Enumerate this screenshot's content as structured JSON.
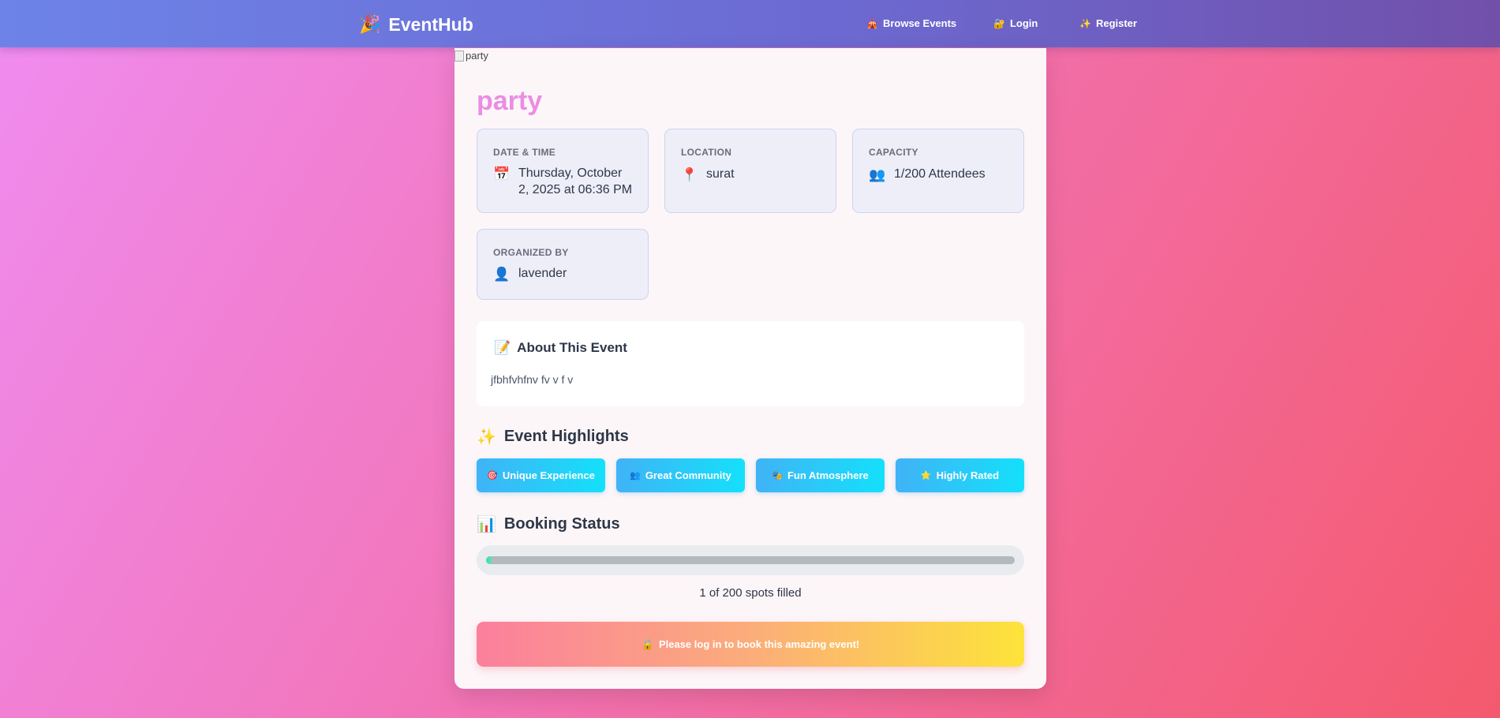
{
  "nav": {
    "brand": "EventHub",
    "brand_icon": "party-popper-icon",
    "links": [
      {
        "label": "Browse Events",
        "icon": "🎪"
      },
      {
        "label": "Login",
        "icon": "🔐"
      },
      {
        "label": "Register",
        "icon": "✨"
      }
    ]
  },
  "event": {
    "image_alt": "party",
    "title": "party",
    "date_label": "DATE & TIME",
    "date_line1": "Thursday, October",
    "date_line2": "2, 2025 at 06:36 PM",
    "location_label": "LOCATION",
    "location": "surat",
    "capacity_label": "CAPACITY",
    "capacity": "1/200 Attendees",
    "organizer_label": "ORGANIZED BY",
    "organizer": "lavender"
  },
  "about": {
    "title": "About This Event",
    "icon": "📝",
    "text": "jfbhfvhfnv fv v f v"
  },
  "highlights": {
    "title": "Event Highlights",
    "icon": "✨",
    "items": [
      {
        "label": "Unique Experience",
        "icon": "🎯"
      },
      {
        "label": "Great Community",
        "icon": "👥"
      },
      {
        "label": "Fun Atmosphere",
        "icon": "🎭"
      },
      {
        "label": "Highly Rated",
        "icon": "⭐"
      }
    ]
  },
  "booking": {
    "title": "Booking Status",
    "icon": "📊",
    "filled": 1,
    "total": 200,
    "spots_text": "1 of 200 spots filled",
    "fill_fraction": 0.005
  },
  "cta": {
    "icon": "🔒",
    "text": "Please log in to book this amazing event!"
  },
  "colors": {
    "accent_title": "#ea8de4",
    "chip_gradient_start": "#40b3f6",
    "chip_gradient_end": "#14e0fa",
    "progress_fill": "#3be39c"
  }
}
